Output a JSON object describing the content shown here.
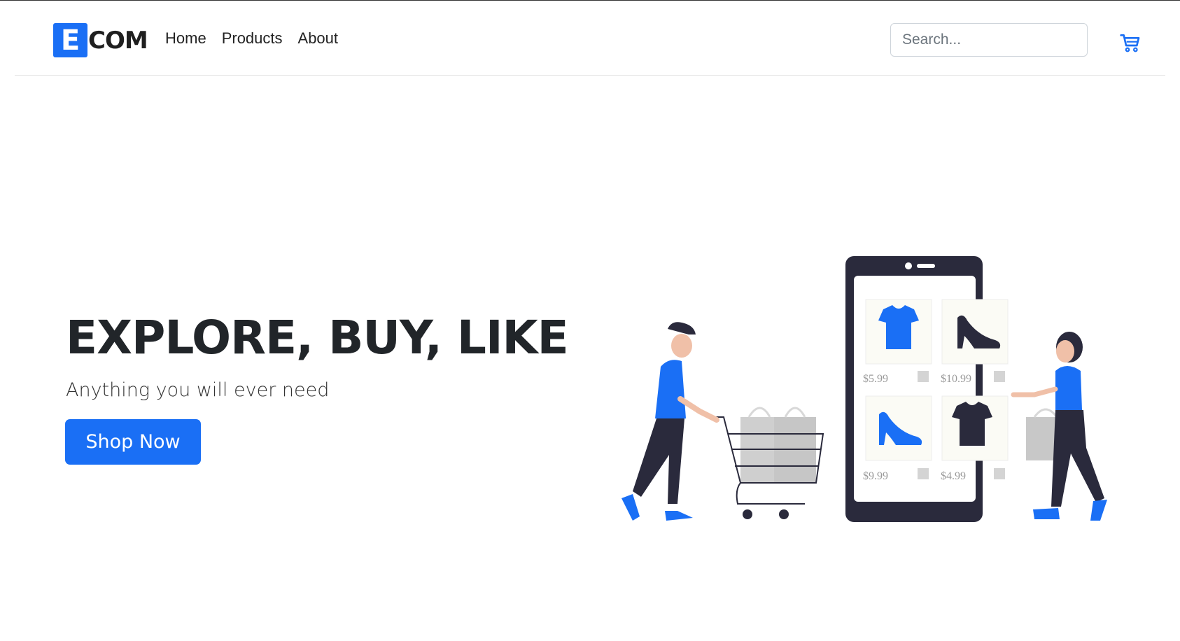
{
  "brand": {
    "letter": "E",
    "name": "COM",
    "accent": "#1a6ff5"
  },
  "nav": {
    "items": [
      "Home",
      "Products",
      "About"
    ]
  },
  "search": {
    "placeholder": "Search..."
  },
  "hero": {
    "title": "EXPLORE, BUY, LIKE",
    "subtitle": "Anything you will ever need",
    "cta": "Shop Now"
  },
  "illustration": {
    "products": [
      {
        "item": "tshirt",
        "price": "$5.99",
        "color": "#1a6ff5"
      },
      {
        "item": "heel",
        "price": "$10.99",
        "color": "#2a2a3c"
      },
      {
        "item": "heel",
        "price": "$9.99",
        "color": "#1a6ff5"
      },
      {
        "item": "tshirt",
        "price": "$4.99",
        "color": "#2a2a3c"
      }
    ]
  },
  "icons": {
    "cart": "cart-icon"
  }
}
